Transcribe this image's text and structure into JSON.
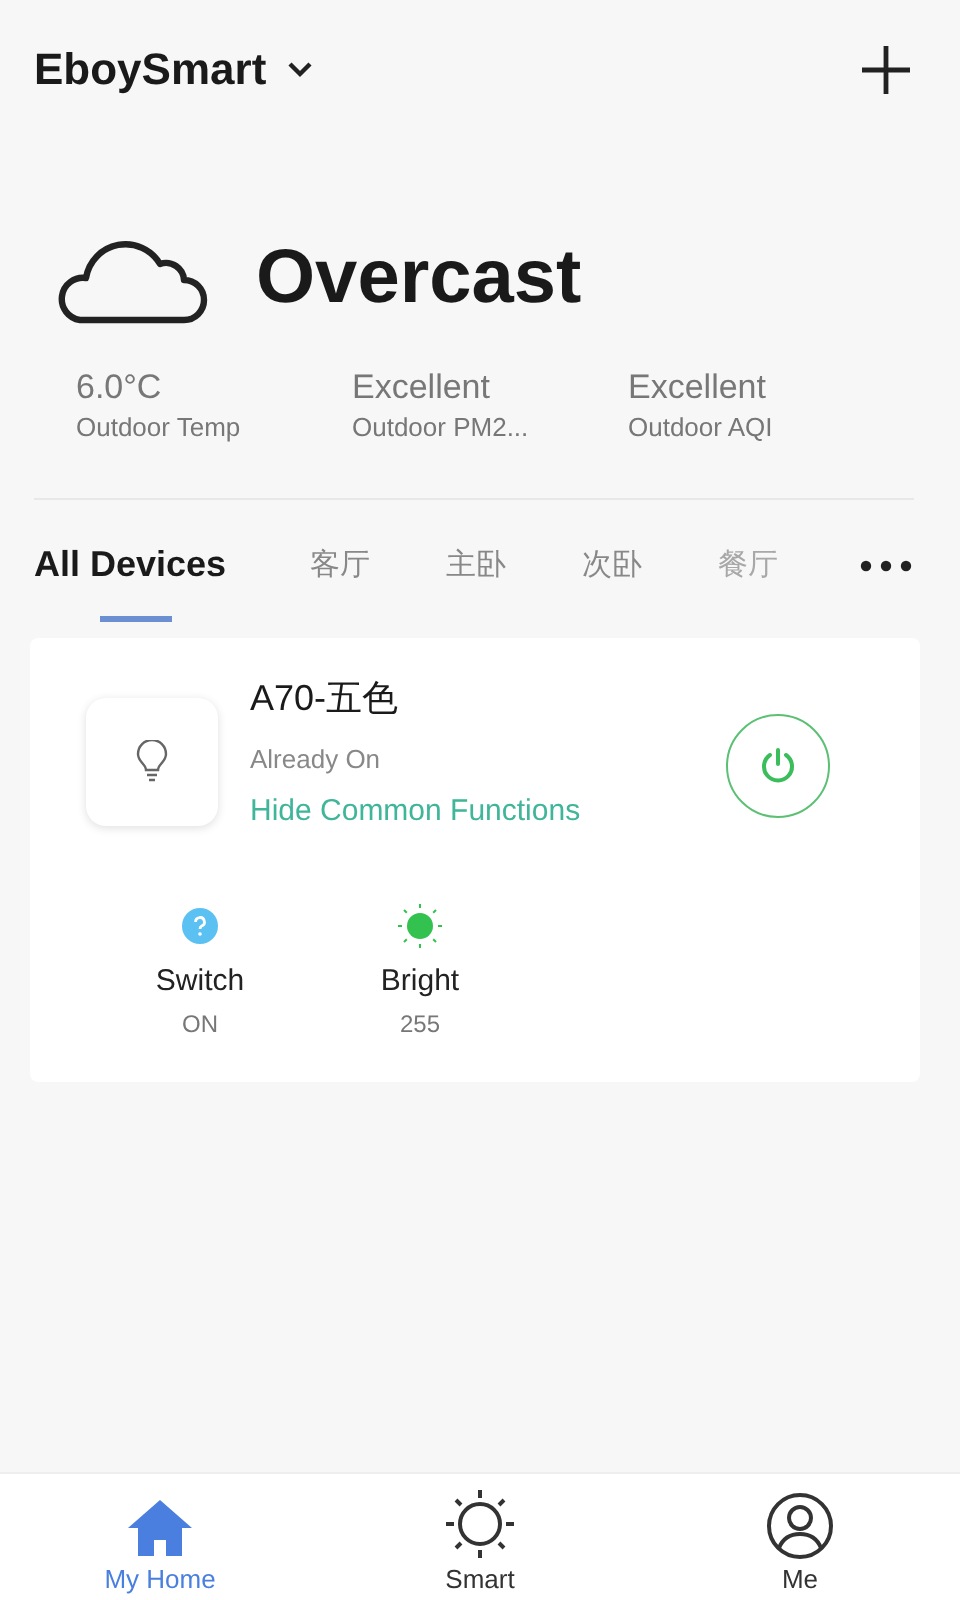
{
  "header": {
    "home_name": "EboySmart"
  },
  "weather": {
    "condition": "Overcast"
  },
  "stats": [
    {
      "value": "6.0°C",
      "label": "Outdoor Temp"
    },
    {
      "value": "Excellent",
      "label": "Outdoor PM2..."
    },
    {
      "value": "Excellent",
      "label": "Outdoor AQI"
    }
  ],
  "tabs": [
    {
      "label": "All Devices",
      "selected": true,
      "faded": false
    },
    {
      "label": "客厅",
      "selected": false,
      "faded": false
    },
    {
      "label": "主卧",
      "selected": false,
      "faded": false
    },
    {
      "label": "次卧",
      "selected": false,
      "faded": false
    },
    {
      "label": "餐厅",
      "selected": false,
      "faded": true
    }
  ],
  "device": {
    "name": "A70-五色",
    "status": "Already On",
    "link": "Hide Common Functions",
    "on": true,
    "functions": [
      {
        "kind": "switch",
        "name": "Switch",
        "value": "ON"
      },
      {
        "kind": "bright",
        "name": "Bright",
        "value": "255"
      }
    ]
  },
  "nav": [
    {
      "kind": "home",
      "label": "My Home",
      "selected": true
    },
    {
      "kind": "smart",
      "label": "Smart",
      "selected": false
    },
    {
      "kind": "me",
      "label": "Me",
      "selected": false
    }
  ]
}
